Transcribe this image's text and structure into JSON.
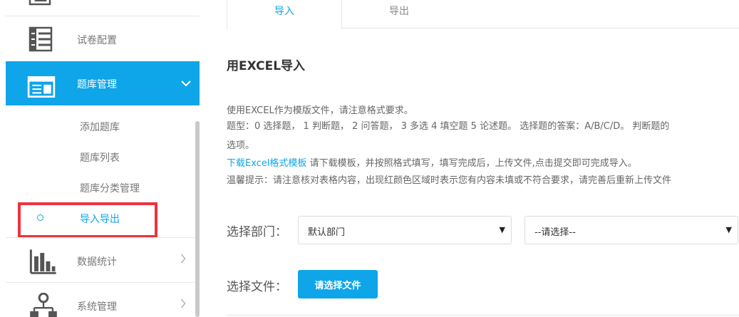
{
  "sidebar": {
    "items": [
      {
        "label": "试卷配置",
        "icon": "paper-config-icon"
      },
      {
        "label": "题库管理",
        "icon": "question-bank-icon"
      },
      {
        "label": "数据统计",
        "icon": "bar-chart-icon"
      },
      {
        "label": "系统管理",
        "icon": "org-chart-icon"
      }
    ],
    "subitems": [
      "添加题库",
      "题库列表",
      "题库分类管理",
      "导入导出"
    ],
    "accent_color": "#0ea5e9",
    "highlight_color": "#ee3340"
  },
  "tabs": [
    "导入",
    "导出"
  ],
  "main": {
    "title": "用EXCEL导入",
    "line1": "使用EXCEL作为模版文件，请注意格式要求。",
    "line2": "题型：0 选择题， 1 判断题， 2 问答题， 3 多选 4 填空题 5 论述题。 选择题的答案：A/B/C/D。 判断题的",
    "line3": "选项。",
    "download_link": "下载Excel格式模板",
    "line4_rest": " 请下载模板，并按照格式填写，填写完成后，上传文件,点击提交即可完成导入。",
    "line5": "温馨提示：请注意核对表格内容，出现红颜色区域时表示您有内容未填或不符合要求，请完善后重新上传文件"
  },
  "form": {
    "dept_label": "选择部门：",
    "dept_value": "默认部门",
    "sub_value": "--请选择--",
    "file_label": "选择文件：",
    "file_button": "请选择文件"
  }
}
